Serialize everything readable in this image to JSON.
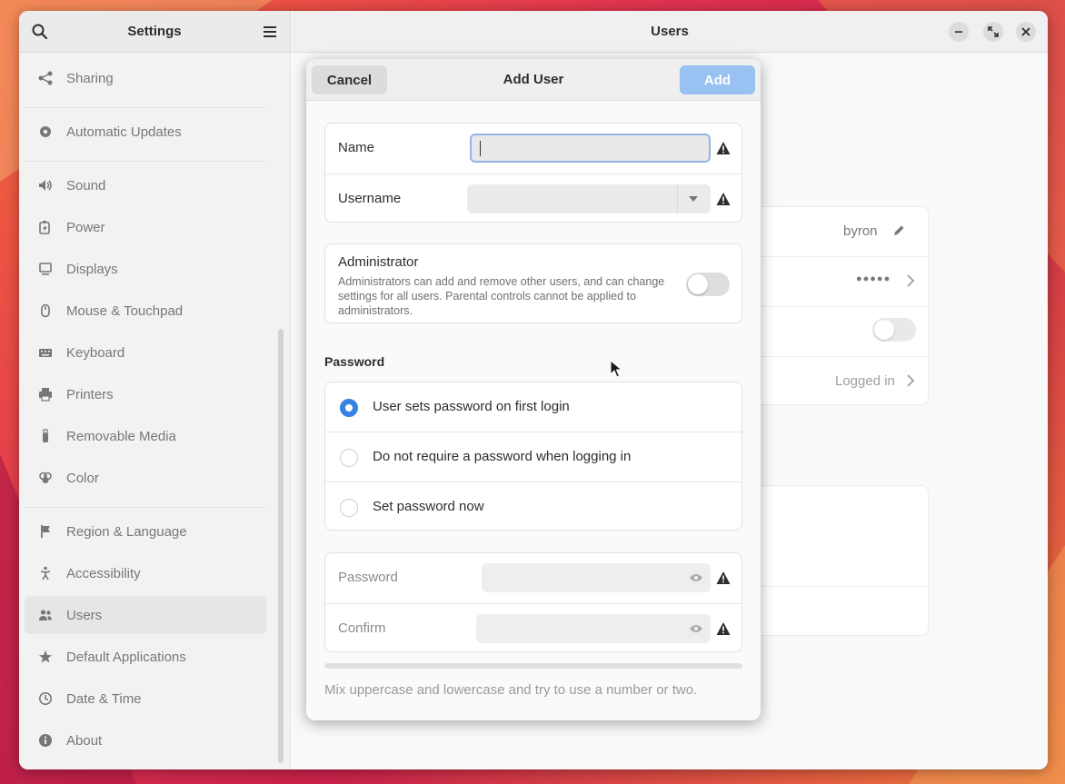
{
  "settings": {
    "title": "Settings",
    "search_icon": "search-icon",
    "menu_icon": "hamburger-menu-icon"
  },
  "sidebar": {
    "items": [
      {
        "label": "Sharing",
        "icon": "share-icon"
      },
      {
        "label": "Automatic Updates",
        "icon": "gear-icon"
      },
      {
        "label": "Sound",
        "icon": "speaker-icon"
      },
      {
        "label": "Power",
        "icon": "battery-icon"
      },
      {
        "label": "Displays",
        "icon": "monitor-icon"
      },
      {
        "label": "Mouse & Touchpad",
        "icon": "mouse-icon"
      },
      {
        "label": "Keyboard",
        "icon": "keyboard-icon"
      },
      {
        "label": "Printers",
        "icon": "printer-icon"
      },
      {
        "label": "Removable Media",
        "icon": "usb-icon"
      },
      {
        "label": "Color",
        "icon": "color-icon"
      },
      {
        "label": "Region & Language",
        "icon": "flag-icon"
      },
      {
        "label": "Accessibility",
        "icon": "accessibility-icon"
      },
      {
        "label": "Users",
        "icon": "users-icon",
        "active": true
      },
      {
        "label": "Default Applications",
        "icon": "star-icon"
      },
      {
        "label": "Date & Time",
        "icon": "clock-icon"
      },
      {
        "label": "About",
        "icon": "info-icon"
      }
    ]
  },
  "main": {
    "title": "Users",
    "username_value": "byron",
    "password_value": "●●●●●",
    "account_activity": "Logged in"
  },
  "dialog": {
    "title": "Add User",
    "cancel_label": "Cancel",
    "add_label": "Add",
    "name_label": "Name",
    "name_value": "",
    "username_label": "Username",
    "username_value": "",
    "admin_title": "Administrator",
    "admin_description": "Administrators can add and remove other users, and can change settings for all users. Parental controls cannot be applied to administrators.",
    "admin_enabled": false,
    "password_section_title": "Password",
    "password_options": [
      {
        "label": "User sets password on first login",
        "selected": true
      },
      {
        "label": "Do not require a password when logging in",
        "selected": false
      },
      {
        "label": "Set password now",
        "selected": false
      }
    ],
    "password_label": "Password",
    "confirm_label": "Confirm",
    "password_strength": 0,
    "hint": "Mix uppercase and lowercase and try to use a number or two."
  },
  "colors": {
    "accent": "#3584e4",
    "add_button_disabled": "#99c1f1"
  }
}
